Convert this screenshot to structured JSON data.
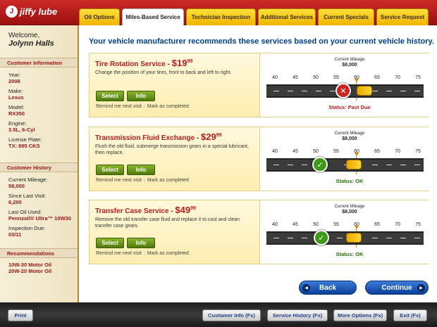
{
  "brand": {
    "logo_text": "jiffy lube"
  },
  "tabs": [
    {
      "label": "Oil Options"
    },
    {
      "label": "Miles-Based Service"
    },
    {
      "label": "Technician Inspection"
    },
    {
      "label": "Additional Services"
    },
    {
      "label": "Current Specials"
    },
    {
      "label": "Service Request"
    }
  ],
  "sidebar": {
    "welcome": "Welcome,",
    "customer_name": "Jolynn Halls",
    "customer_information": {
      "heading": "Customer Information",
      "year_label": "Year:",
      "year": "2008",
      "make_label": "Make:",
      "make": "Lexus",
      "model_label": "Model:",
      "model": "RX350",
      "engine_label": "Engine:",
      "engine": "3.5L, 6-Cyl",
      "plate_label": "License Plate:",
      "plate": "TX: 895 CKS"
    },
    "customer_history": {
      "heading": "Customer History",
      "current_mileage_label": "Current Mileage:",
      "current_mileage": "58,000",
      "since_last_visit_label": "Since Last Visit:",
      "since_last_visit": "6,200",
      "last_oil_label": "Last Oil Used:",
      "last_oil": "Pennzoil® Ultra™ 10W30",
      "inspection_due_label": "Inspection Due:",
      "inspection_due": "03/11"
    },
    "recommendations": {
      "heading": "Recommendations",
      "items": [
        "10W-30 Motor Oil",
        "20W-20 Motor Oil"
      ]
    }
  },
  "main": {
    "headline": "Your vehicle manufacturer recommends these services based on your current vehicle history.",
    "services": [
      {
        "name": "Tire Rotation Service - ",
        "dollar": "$",
        "price_main": "19",
        "price_cents": "99",
        "description": "Change the position of your tires, front to back and left to right.",
        "select": "Select",
        "info": "Info",
        "remind": "Remind me next visit",
        "mark": "Mark as completed",
        "current_mileage_label": "Current Mileage",
        "current_mileage": "$8,000",
        "status": "Status: Past Due",
        "status_icon": "x-icon",
        "status_color": "#c8261e"
      },
      {
        "name": "Transmission Fluid Exchange - ",
        "dollar": "$",
        "price_main": "29",
        "price_cents": "99",
        "description": "Flush the old fluid, submerge transmission gears in a special lubricant, then replace.",
        "select": "Select",
        "info": "Info",
        "remind": "Remind me next visit",
        "mark": "Mark as completed",
        "current_mileage_label": "Current Mileage",
        "current_mileage": "$8,000",
        "status": "Status: OK",
        "status_icon": "check-icon",
        "status_color": "#3f9a1a"
      },
      {
        "name": "Transfer Case Service - ",
        "dollar": "$",
        "price_main": "49",
        "price_cents": "99",
        "description": "Remove the old transfer case fluid and replace it to cool and clean transfer case gears.",
        "select": "Select",
        "info": "Info",
        "remind": "Remind me next visit",
        "mark": "Mark as completed",
        "current_mileage_label": "Current Mileage",
        "current_mileage": "$8,000",
        "status": "Status: OK",
        "status_icon": "check-icon",
        "status_color": "#3f9a1a"
      }
    ],
    "mileage_ticks": [
      "40",
      "45",
      "50",
      "55",
      "60",
      "65",
      "70",
      "75"
    ],
    "back": "Back",
    "continue": "Continue"
  },
  "footer": {
    "print": "Print",
    "customer_info": "Customer Info (Fx)",
    "service_history": "Service History (Fx)",
    "more_options": "More Options (Fx)",
    "exit": "Exit (Fx)"
  }
}
